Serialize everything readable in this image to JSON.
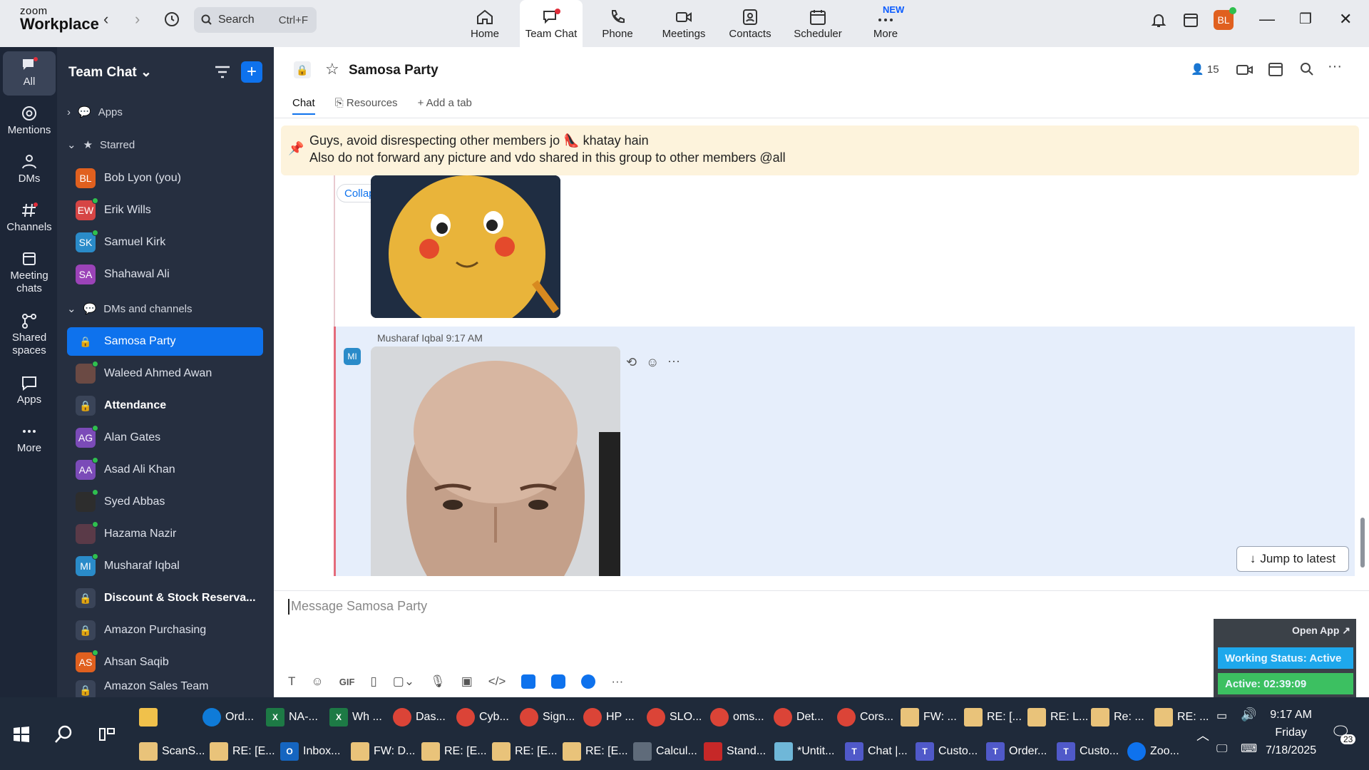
{
  "app": {
    "logo_top": "zoom",
    "logo_bottom": "Workplace"
  },
  "search": {
    "placeholder": "Search",
    "shortcut": "Ctrl+F"
  },
  "topnav": [
    {
      "label": "Home",
      "icon": "home-icon"
    },
    {
      "label": "Team Chat",
      "icon": "chat-icon",
      "active": true
    },
    {
      "label": "Phone",
      "icon": "phone-icon"
    },
    {
      "label": "Meetings",
      "icon": "video-icon"
    },
    {
      "label": "Contacts",
      "icon": "contacts-icon"
    },
    {
      "label": "Scheduler",
      "icon": "calendar-icon"
    },
    {
      "label": "More",
      "icon": "more-icon",
      "badge": "NEW"
    }
  ],
  "profile": {
    "initials": "BL",
    "color": "#e0601f"
  },
  "rail": [
    {
      "label": "All"
    },
    {
      "label": "Mentions"
    },
    {
      "label": "DMs"
    },
    {
      "label": "Channels"
    },
    {
      "label": "Meeting chats"
    },
    {
      "label": "Shared spaces"
    },
    {
      "label": "Apps"
    },
    {
      "label": "More"
    }
  ],
  "sidebar": {
    "title": "Team Chat",
    "apps": "Apps",
    "starred": "Starred",
    "starred_items": [
      {
        "name": "Bob Lyon (you)",
        "initials": "BL",
        "color": "#e0601f"
      },
      {
        "name": "Erik Wills",
        "initials": "EW",
        "color": "#d64545"
      },
      {
        "name": "Samuel Kirk",
        "initials": "SK",
        "color": "#2a8bc9"
      },
      {
        "name": "Shahawal Ali",
        "initials": "SA",
        "color": "#9b43b8"
      }
    ],
    "dms_section": "DMs and channels",
    "dm_items": [
      {
        "name": "Samosa Party",
        "type": "lock",
        "selected": true
      },
      {
        "name": "Waleed Ahmed Awan",
        "type": "photo"
      },
      {
        "name": "Attendance",
        "type": "lock",
        "bold": true
      },
      {
        "name": "Alan Gates",
        "initials": "AG",
        "color": "#7b4bb8"
      },
      {
        "name": "Asad Ali Khan",
        "initials": "AA",
        "color": "#7b4bb8"
      },
      {
        "name": "Syed Abbas",
        "type": "photo"
      },
      {
        "name": "Hazama Nazir",
        "type": "photo"
      },
      {
        "name": "Musharaf Iqbal",
        "initials": "MI",
        "color": "#2a8bc9"
      },
      {
        "name": "Discount & Stock Reserva...",
        "type": "lock",
        "bold": true
      },
      {
        "name": "Amazon Purchasing",
        "type": "lock"
      },
      {
        "name": "Ahsan Saqib",
        "initials": "AS",
        "color": "#e0601f"
      },
      {
        "name": "Amazon Sales Team",
        "type": "lock"
      }
    ]
  },
  "channel": {
    "title": "Samosa Party",
    "member_count": "15",
    "tabs": [
      "Chat",
      "Resources",
      "Add a tab"
    ],
    "pinned_line1": "Guys, avoid disrespecting other members jo 👠 khatay hain",
    "pinned_line2": "Also do not forward any picture and vdo shared in this group to other members @all",
    "collapse": "Collapse all",
    "message": {
      "sender": "Musharaf Iqbal",
      "time": "9:17 AM",
      "initials": "MI"
    },
    "jump": "Jump to latest",
    "composer_placeholder": "Message Samosa Party"
  },
  "widget": {
    "open": "Open App ↗",
    "status": "Working Status: Active",
    "active": "Active: 02:39:09"
  },
  "taskbar": {
    "row1": [
      {
        "label": "",
        "color": "#f0c14b",
        "sq": true
      },
      {
        "label": "Ord...",
        "color": "#0f7bd8"
      },
      {
        "label": "NA-...",
        "color": "#1d7a45",
        "sq": true,
        "letter": "X"
      },
      {
        "label": "Wh ...",
        "color": "#1d7a45",
        "sq": true,
        "letter": "X"
      },
      {
        "label": "Das...",
        "color": "#db4437"
      },
      {
        "label": "Cyb...",
        "color": "#db4437"
      },
      {
        "label": "Sign...",
        "color": "#db4437"
      },
      {
        "label": "HP ...",
        "color": "#db4437"
      },
      {
        "label": "SLO...",
        "color": "#db4437"
      },
      {
        "label": "oms...",
        "color": "#db4437"
      },
      {
        "label": "Det...",
        "color": "#db4437"
      },
      {
        "label": "Cors...",
        "color": "#db4437"
      },
      {
        "label": "FW: ...",
        "color": "#e9c37a",
        "sq": true
      },
      {
        "label": "RE: [...",
        "color": "#e9c37a",
        "sq": true
      },
      {
        "label": "RE: L...",
        "color": "#e9c37a",
        "sq": true
      },
      {
        "label": "Re: ...",
        "color": "#e9c37a",
        "sq": true
      },
      {
        "label": "RE: ...",
        "color": "#e9c37a",
        "sq": true
      }
    ],
    "row2": [
      {
        "label": "ScanS...",
        "color": "#e9c37a",
        "sq": true
      },
      {
        "label": "RE: [E...",
        "color": "#e9c37a",
        "sq": true
      },
      {
        "label": "Inbox...",
        "color": "#1565c0",
        "sq": true,
        "letter": "O"
      },
      {
        "label": "FW: D...",
        "color": "#e9c37a",
        "sq": true
      },
      {
        "label": "RE: [E...",
        "color": "#e9c37a",
        "sq": true
      },
      {
        "label": "RE: [E...",
        "color": "#e9c37a",
        "sq": true
      },
      {
        "label": "RE: [E...",
        "color": "#e9c37a",
        "sq": true
      },
      {
        "label": "Calcul...",
        "color": "#5f6b7a",
        "sq": true
      },
      {
        "label": "Stand...",
        "color": "#c62828",
        "sq": true
      },
      {
        "label": "*Untit...",
        "color": "#6fb7d8",
        "sq": true
      },
      {
        "label": "Chat |...",
        "color": "#5059c9",
        "sq": true,
        "letter": "T"
      },
      {
        "label": "Custo...",
        "color": "#5059c9",
        "sq": true,
        "letter": "T"
      },
      {
        "label": "Order...",
        "color": "#5059c9",
        "sq": true,
        "letter": "T"
      },
      {
        "label": "Custo...",
        "color": "#5059c9",
        "sq": true,
        "letter": "T"
      },
      {
        "label": "Zoo...",
        "color": "#0e72ed"
      }
    ],
    "time": "9:17 AM",
    "day": "Friday",
    "date": "7/18/2025",
    "notif": "23"
  }
}
